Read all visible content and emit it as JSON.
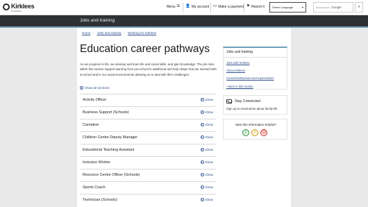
{
  "header": {
    "logo_name": "Kirklees",
    "logo_sub": "COUNCIL",
    "nav": {
      "menu": "Menu",
      "account": "My account",
      "payment": "Make a payment",
      "report": "Report it"
    },
    "language_select": "Select Language",
    "search_powered": "ENHANCED BY",
    "search_brand": "Google"
  },
  "banner": {
    "title": "Jobs and training"
  },
  "breadcrumb": [
    "Home",
    "Jobs and training",
    "Working for Kirklees"
  ],
  "page_title": "Education career pathways",
  "intro": "As we progress in life, we develop and learn life and social skills, and gain knowledge. The job roles within this section support learning from pre-school to adulthood and help shape how we interact both at school and in our social environments allowing us to deal with life's challenges.",
  "show_all_label": "Show all sections",
  "accordion": {
    "show_label": "Show",
    "items": [
      "Activity Officer",
      "Business Support (Schools)",
      "Caretaker",
      "Children Centre Deputy Manager",
      "Educational Teaching Assistant",
      "Inclusion Worker",
      "Resource Centre Officer (Schools)",
      "Sports Coach",
      "Technician (Schools)"
    ]
  },
  "sidebar": {
    "heading": "Jobs and training",
    "links": [
      "Jobs with Kirklees",
      "About Kirklees",
      "Council behaviours and expectations",
      "› More in this section"
    ],
    "stay_title": "Stay Connected",
    "stay_text": "Sign up to email alerts about family life",
    "helpful_question": "Was this information helpful?"
  },
  "colors": {
    "accent": "#6c9fb7",
    "link": "#2c4f8a",
    "banner": "#2f3034"
  }
}
